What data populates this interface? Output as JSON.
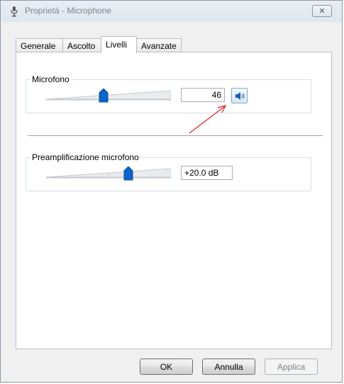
{
  "window": {
    "title": "Proprietà - Microphone",
    "title_icon": "microphone-icon",
    "close_icon": "close-icon"
  },
  "tabs": [
    {
      "label": "Generale",
      "active": false
    },
    {
      "label": "Ascolto",
      "active": false
    },
    {
      "label": "Livelli",
      "active": true
    },
    {
      "label": "Avanzate",
      "active": false
    }
  ],
  "levels": {
    "microphone": {
      "label": "Microfono",
      "value": "46",
      "level_percent": 46,
      "mute_icon": "speaker-icon"
    },
    "boost": {
      "label": "Preamplificazione microfono",
      "value": "+20.0 dB",
      "level_fraction": 0.67
    }
  },
  "buttons": {
    "ok": "OK",
    "cancel": "Annulla",
    "apply": "Applica"
  },
  "colors": {
    "accent": "#0a64c8",
    "annotation": "#e02020"
  }
}
